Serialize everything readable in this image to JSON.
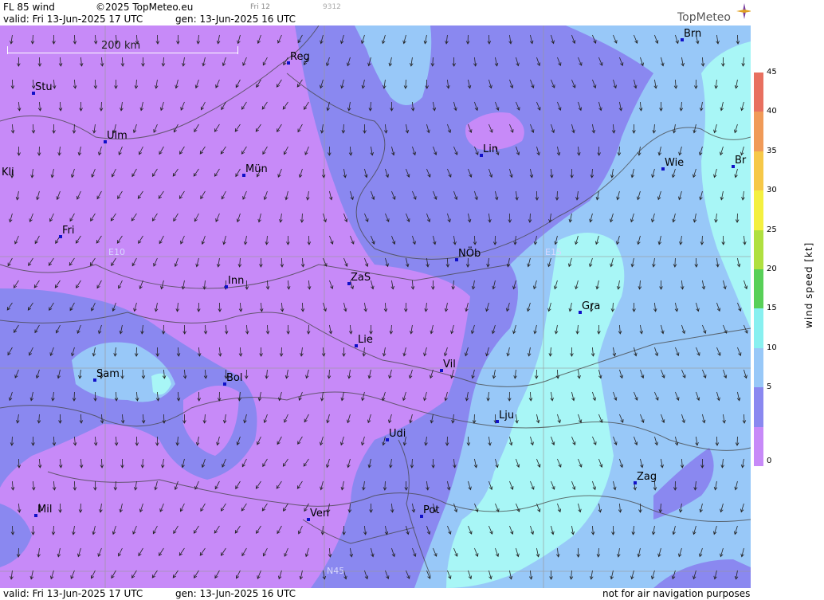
{
  "header": {
    "title": "FL 85 wind",
    "copyright": "©2025 TopMeteo.eu",
    "run_day": "Fri 12",
    "code": "9312",
    "valid": "valid:  Fri  13-Jun-2025  17 UTC",
    "gen": "gen: 13-Jun-2025 16 UTC",
    "logo": "TopMeteo"
  },
  "footer": {
    "valid": "valid:  Fri  13-Jun-2025  17 UTC",
    "gen": "gen: 13-Jun-2025 16 UTC",
    "disclaimer": "not for air navigation purposes"
  },
  "scale_bar": {
    "label": "200 km"
  },
  "grid_labels": {
    "e10": "E10",
    "e15": "E15",
    "n45": "N45"
  },
  "cities": [
    {
      "id": "stu",
      "label": "Stu"
    },
    {
      "id": "ulm",
      "label": "Ulm"
    },
    {
      "id": "kli",
      "label": "Kli"
    },
    {
      "id": "mun",
      "label": "Mün"
    },
    {
      "id": "fri",
      "label": "Fri"
    },
    {
      "id": "reg",
      "label": "Reg"
    },
    {
      "id": "lin",
      "label": "Lin"
    },
    {
      "id": "wie",
      "label": "Wie"
    },
    {
      "id": "brn",
      "label": "Brn"
    },
    {
      "id": "bra",
      "label": "Br"
    },
    {
      "id": "inn",
      "label": "Inn"
    },
    {
      "id": "zas",
      "label": "ZaS"
    },
    {
      "id": "nob",
      "label": "NÖb"
    },
    {
      "id": "gra",
      "label": "Gra"
    },
    {
      "id": "lie",
      "label": "Lie"
    },
    {
      "id": "vil",
      "label": "Vil"
    },
    {
      "id": "sam",
      "label": "Sam"
    },
    {
      "id": "bol",
      "label": "Bol"
    },
    {
      "id": "lju",
      "label": "Lju"
    },
    {
      "id": "udi",
      "label": "Udi"
    },
    {
      "id": "zag",
      "label": "Zag"
    },
    {
      "id": "mil",
      "label": "Mil"
    },
    {
      "id": "ven",
      "label": "Ven"
    },
    {
      "id": "pot",
      "label": "Pot"
    }
  ],
  "legend": {
    "unit_label": "wind speed [kt]",
    "ticks": [
      "45",
      "40",
      "35",
      "30",
      "25",
      "20",
      "15",
      "10",
      "5",
      "0"
    ],
    "colors": [
      "#e87060",
      "#f09a58",
      "#f6c848",
      "#f4f040",
      "#b0e040",
      "#58d058",
      "#88f0f0",
      "#98c8f8",
      "#8a88f0",
      "#c78af8"
    ]
  },
  "colors": {
    "speed_0_5": "#c78af8",
    "speed_5_10": "#8a88f0",
    "speed_10_15": "#98c8f8",
    "speed_15_20": "#a8f6f6"
  }
}
